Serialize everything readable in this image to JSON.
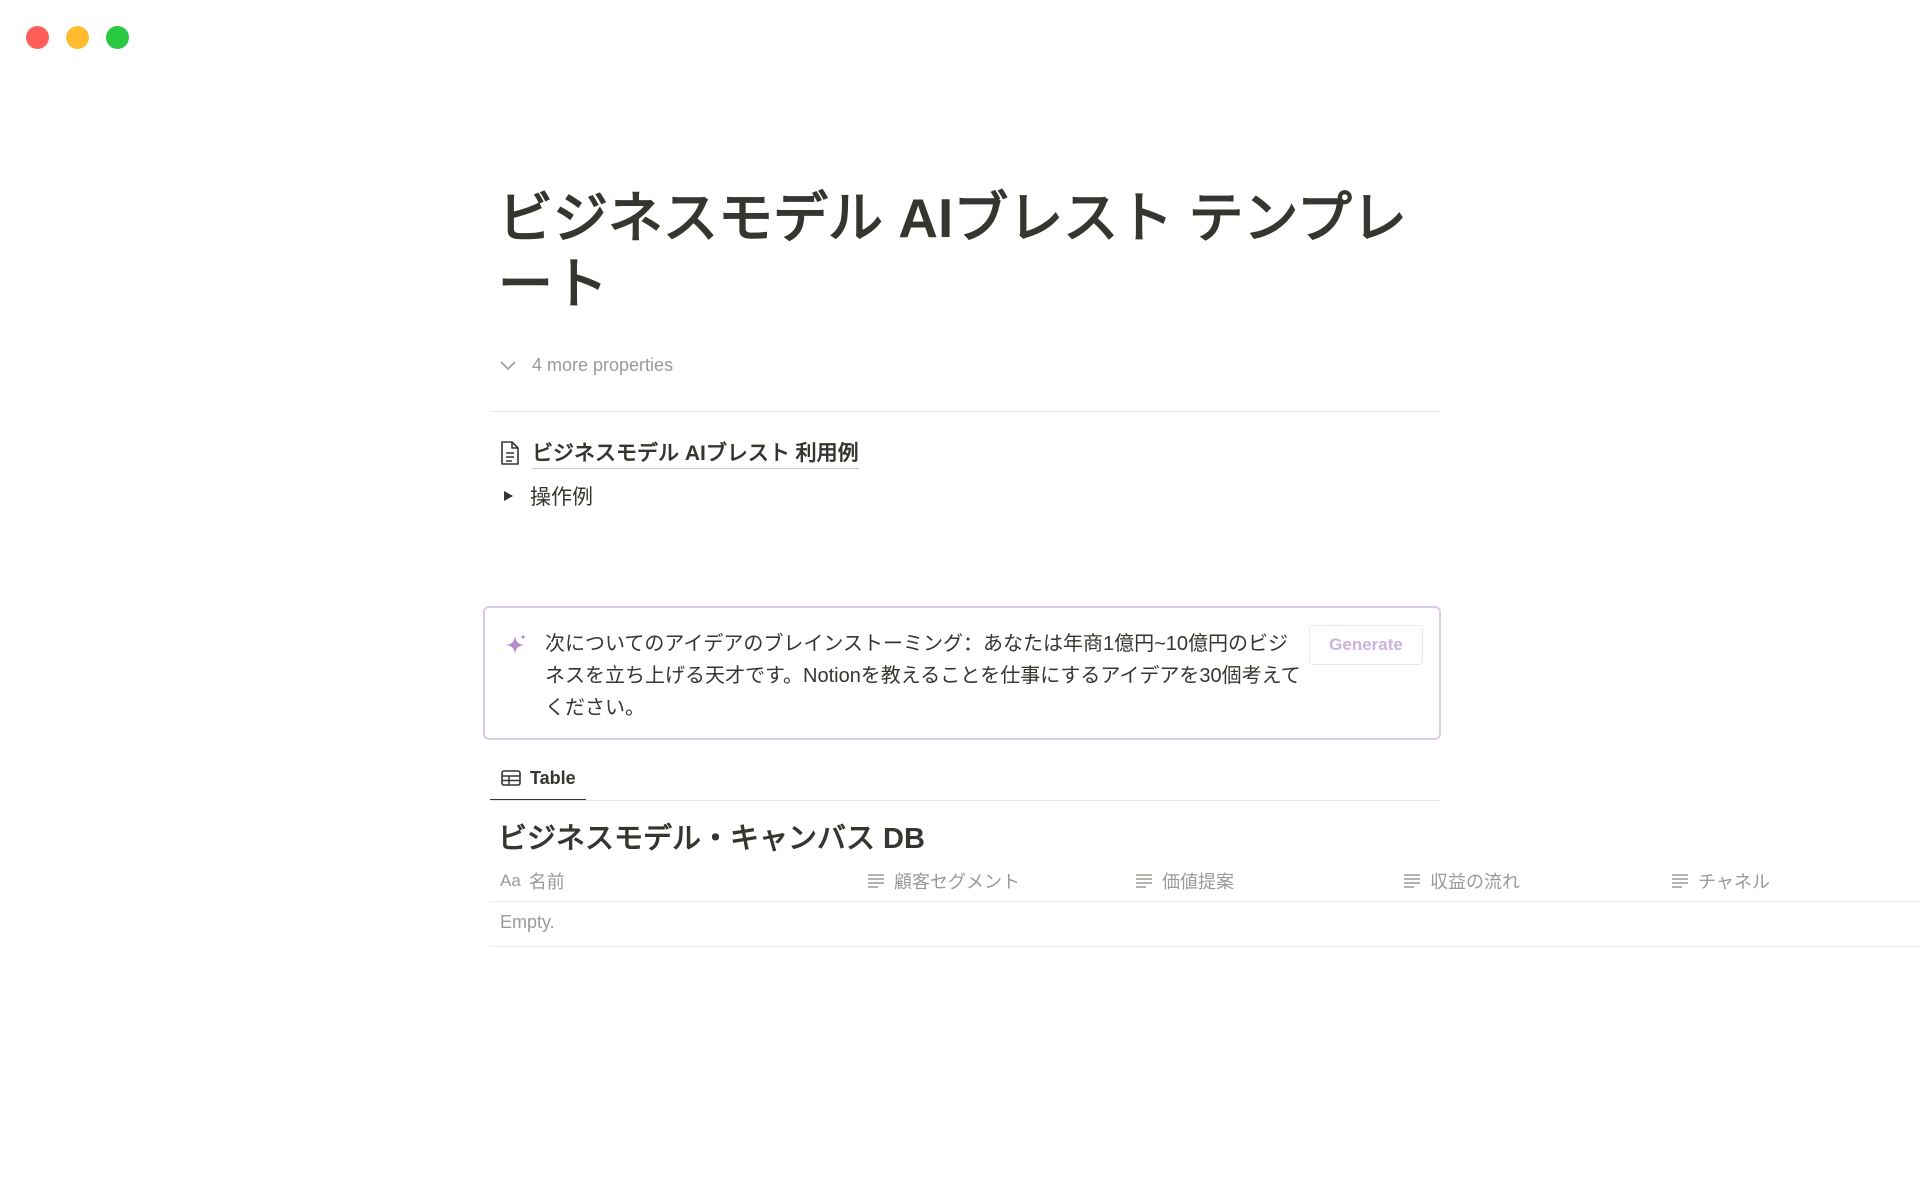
{
  "title": "ビジネスモデル AIブレスト テンプレート",
  "properties_toggle": "4 more properties",
  "page_link": "ビジネスモデル AIブレスト 利用例",
  "toggle_block": "操作例",
  "ai_block": {
    "prompt": "次についてのアイデアのブレインストーミング：あなたは年商1億円~10億円のビジネスを立ち上げる天才です。Notionを教えることを仕事にするアイデアを30個考えてください。",
    "button": "Generate"
  },
  "view_tab": "Table",
  "database": {
    "title": "ビジネスモデル・キャンバス DB",
    "name_prefix": "Aa",
    "columns": [
      "名前",
      "顧客セグメント",
      "価値提案",
      "収益の流れ",
      "チャネル"
    ],
    "empty": "Empty."
  }
}
